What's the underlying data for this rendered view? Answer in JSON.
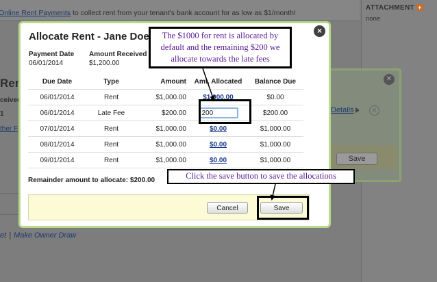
{
  "background": {
    "top_link": "Online Rent Payments",
    "top_text": " to collect rent from your tenant's bank account for as low as $1/month!",
    "attachment_label": "ATTACHMENT",
    "attachment_value": "none",
    "left_heading": "Ren",
    "left_received": "ceived",
    "left_one": "1",
    "left_other_link": "ther F",
    "details_link": "Details",
    "save_label": "Save",
    "bottom_link_1": "et",
    "bottom_separator": "|",
    "bottom_link_2": "Make Owner Draw"
  },
  "modal": {
    "title": "Allocate Rent - Jane Doe",
    "payment_date_label": "Payment Date",
    "payment_date_value": "06/01/2014",
    "amount_received_label": "Amount Received",
    "amount_received_value": "$1,200.00",
    "columns": [
      "Due Date",
      "Type",
      "Amount",
      "Amt. Allocated",
      "Balance Due"
    ],
    "rows": [
      {
        "due_date": "06/01/2014",
        "type": "Rent",
        "amount": "$1,000.00",
        "allocated": "$1,000.00",
        "balance": "$0.00"
      },
      {
        "due_date": "06/01/2014",
        "type": "Late Fee",
        "amount": "$200.00",
        "allocated": "200",
        "balance": "$200.00"
      },
      {
        "due_date": "07/01/2014",
        "type": "Rent",
        "amount": "$1,000.00",
        "allocated": "$0.00",
        "balance": "$1,000.00"
      },
      {
        "due_date": "08/01/2014",
        "type": "Rent",
        "amount": "$1,000.00",
        "allocated": "$0.00",
        "balance": "$1,000.00"
      },
      {
        "due_date": "09/01/2014",
        "type": "Rent",
        "amount": "$1,000.00",
        "allocated": "$0.00",
        "balance": "$1,000.00"
      }
    ],
    "remainder_text": "Remainder amount to allocate: $200.00",
    "cancel_label": "Cancel",
    "save_label": "Save",
    "close_glyph": "×"
  },
  "annotations": {
    "callout_1": "The $1000 for rent is allocated by default and the remaining $200 we allocate towards the late fees",
    "callout_2": "Click the save button to save the allocations"
  }
}
